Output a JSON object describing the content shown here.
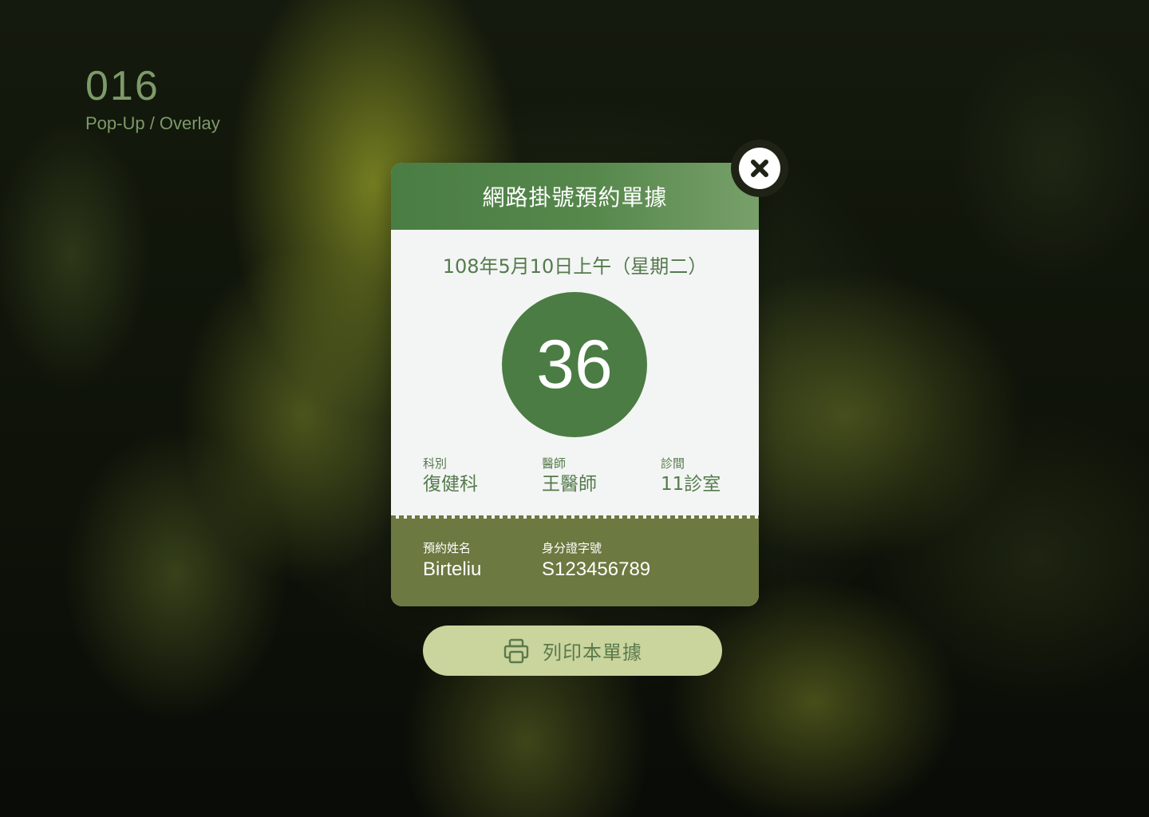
{
  "brand": {
    "number": "016",
    "subtitle": "Pop-Up / Overlay"
  },
  "card": {
    "title": "網路掛號預約單據",
    "date": "108年5月10日上午（星期二）",
    "ticket_number": "36",
    "info": [
      {
        "label": "科別",
        "value": "復健科"
      },
      {
        "label": "醫師",
        "value": "王醫師"
      },
      {
        "label": "診間",
        "value": "11診室"
      }
    ],
    "footer": [
      {
        "label": "預約姓名",
        "value": "Birteliu"
      },
      {
        "label": "身分證字號",
        "value": "S123456789"
      }
    ]
  },
  "close_button": {
    "icon": "close-icon"
  },
  "print_button": {
    "label": "列印本單據",
    "icon": "printer-icon"
  },
  "colors": {
    "header_green": "#4a7d44",
    "circle_green": "#4a7c43",
    "footer_olive": "#6c7940",
    "button_fill": "#cad49d",
    "text_green": "#557a4c"
  }
}
